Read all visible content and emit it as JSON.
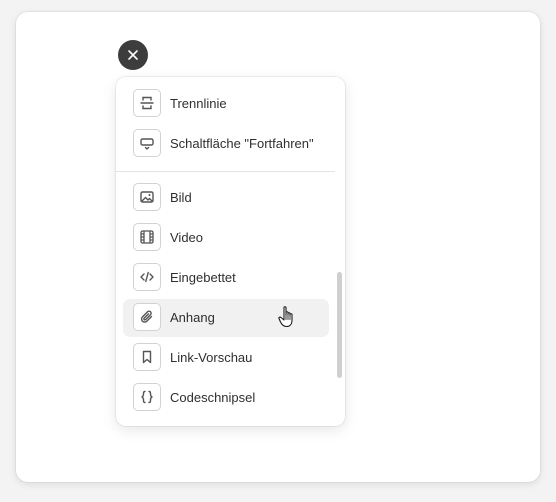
{
  "close_button": {
    "icon": "close-icon"
  },
  "menu": {
    "items": [
      {
        "label": "Trennlinie",
        "icon": "divider-icon"
      },
      {
        "label": "Schaltfläche \"Fortfahren\"",
        "icon": "button-icon"
      },
      {
        "label": "Bild",
        "icon": "image-icon"
      },
      {
        "label": "Video",
        "icon": "video-icon"
      },
      {
        "label": "Eingebettet",
        "icon": "code-embed-icon"
      },
      {
        "label": "Anhang",
        "icon": "paperclip-icon",
        "hovered": true
      },
      {
        "label": "Link-Vorschau",
        "icon": "bookmark-icon"
      },
      {
        "label": "Codeschnipsel",
        "icon": "braces-icon"
      }
    ]
  },
  "colors": {
    "close_bg": "#3d3d3d",
    "hover_bg": "#f1f1f1",
    "text": "#2f2f2f",
    "icon_stroke": "#555555"
  }
}
